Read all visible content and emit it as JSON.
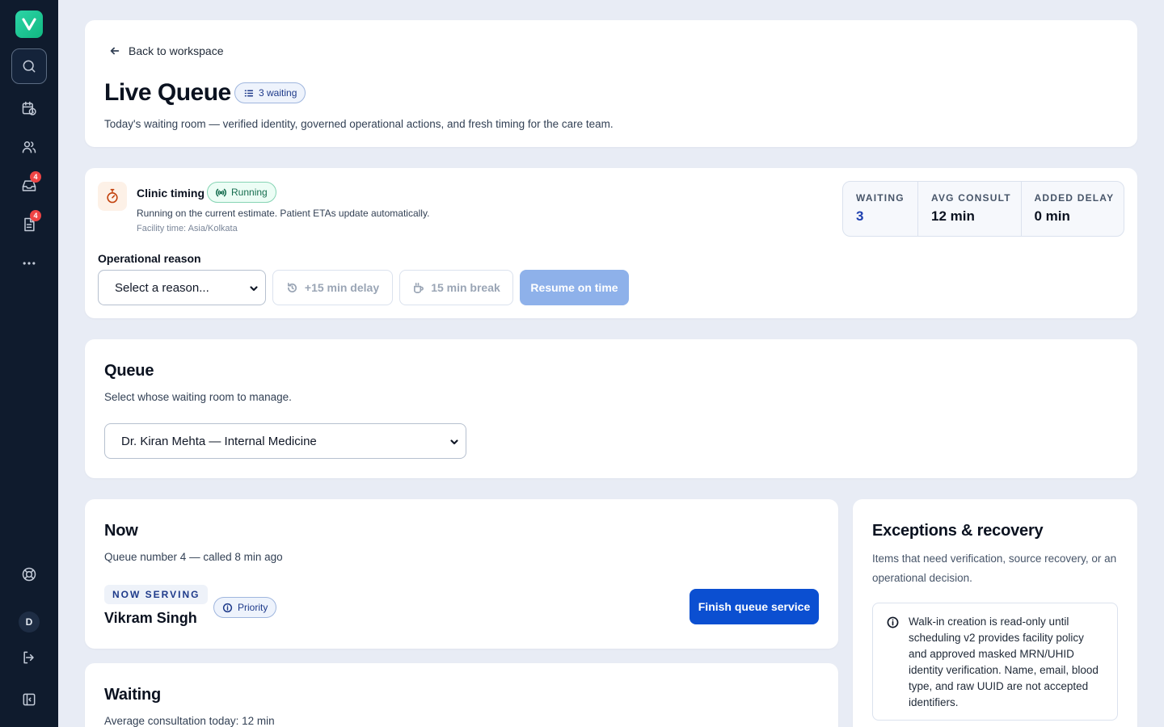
{
  "sidebar": {
    "badges": {
      "inbox": "4",
      "documents": "4"
    },
    "avatar_initial": "D"
  },
  "header": {
    "back_label": "Back to workspace",
    "title": "Live Queue",
    "waiting_pill": "3 waiting",
    "subtitle": "Today's waiting room — verified identity, governed operational actions, and fresh timing for the care team."
  },
  "timing": {
    "title": "Clinic timing",
    "status": "Running",
    "description": "Running on the current estimate. Patient ETAs update automatically.",
    "facility_time": "Facility time: Asia/Kolkata",
    "stats": [
      {
        "label": "WAITING",
        "value": "3"
      },
      {
        "label": "AVG CONSULT",
        "value": "12 min"
      },
      {
        "label": "ADDED DELAY",
        "value": "0 min"
      }
    ],
    "reason_label": "Operational reason",
    "reason_select": "Select a reason...",
    "delay_button": "+15 min delay",
    "break_button": "15 min break",
    "resume_button": "Resume on time"
  },
  "queue": {
    "title": "Queue",
    "subtitle": "Select whose waiting room to manage.",
    "selected": "Dr. Kiran Mehta — Internal Medicine"
  },
  "now": {
    "title": "Now",
    "subtitle": "Queue number 4 — called 8 min ago",
    "tag": "NOW SERVING",
    "patient": "Vikram Singh",
    "priority": "Priority",
    "finish_button": "Finish queue service"
  },
  "waiting": {
    "title": "Waiting",
    "subtitle": "Average consultation today: 12 min"
  },
  "exceptions": {
    "title": "Exceptions & recovery",
    "description": "Items that need verification, source recovery, or an operational decision.",
    "notice": "Walk-in creation is read-only until scheduling v2 provides facility policy and approved masked MRN/UHID identity verification. Name, email, blood type, and raw UUID are not accepted identifiers."
  },
  "colors": {
    "sidebar": "#0f1b2d",
    "primary": "#0b4fd1",
    "background": "#e8ecf5",
    "badge": "#ef4444"
  }
}
